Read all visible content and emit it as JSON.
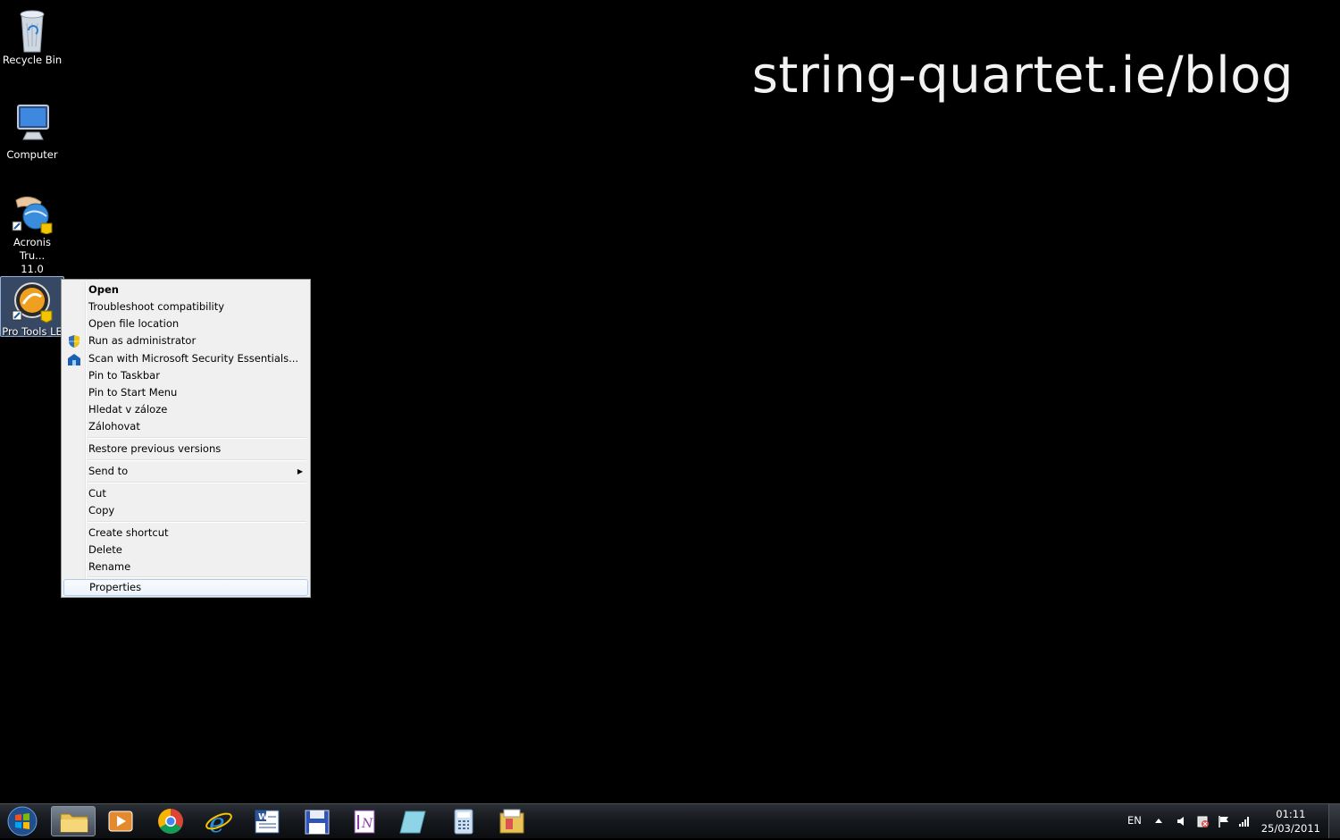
{
  "watermark": "string-quartet.ie/blog",
  "desktop_icons": [
    {
      "label": "Recycle Bin"
    },
    {
      "label": "Computer"
    },
    {
      "label": "Acronis Tru...\n11.0",
      "line1": "Acronis Tru...",
      "line2": "11.0"
    },
    {
      "label": "Pro Tools LE"
    }
  ],
  "context_menu": {
    "open": "Open",
    "troubleshoot": "Troubleshoot compatibility",
    "open_location": "Open file location",
    "run_admin": "Run as administrator",
    "scan": "Scan with Microsoft Security Essentials...",
    "pin_taskbar": "Pin to Taskbar",
    "pin_start": "Pin to Start Menu",
    "hledat": "Hledat v záloze",
    "zalohovat": "Zálohovat",
    "restore": "Restore previous versions",
    "send_to": "Send to",
    "cut": "Cut",
    "copy": "Copy",
    "create_shortcut": "Create shortcut",
    "delete": "Delete",
    "rename": "Rename",
    "properties": "Properties"
  },
  "taskbar": {
    "apps": [
      "windows-explorer",
      "media-player",
      "chrome",
      "internet-explorer",
      "word",
      "save-app",
      "onenote",
      "notes",
      "calculator",
      "archive"
    ],
    "language": "EN",
    "time": "01:11",
    "date": "25/03/2011"
  },
  "colors": {
    "desktop": "#000000",
    "menu_bg": "#f0f0f0",
    "highlight_border": "#aeccf1"
  }
}
